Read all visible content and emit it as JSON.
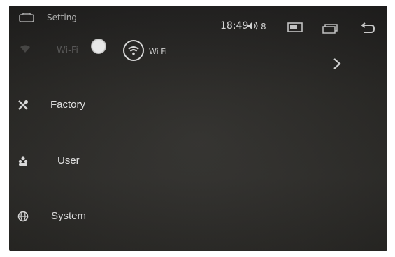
{
  "header": {
    "title": "Setting",
    "home_icon": "home-icon"
  },
  "status": {
    "time": "18:49",
    "volume_level": "8",
    "icons": [
      "volume-icon",
      "gallery-icon",
      "windows-icon",
      "back-icon"
    ]
  },
  "wifi": {
    "label": "Wi-Fi",
    "toggle_state": "on",
    "network_name": "Wi Fi",
    "icons": [
      "wifi-signal-icon",
      "wifi-network-icon",
      "chevron-right-icon"
    ]
  },
  "menu": {
    "items": [
      {
        "label": "Factory",
        "icon": "tools-icon"
      },
      {
        "label": "User",
        "icon": "users-icon"
      },
      {
        "label": "System",
        "icon": "globe-icon"
      }
    ]
  },
  "colors": {
    "screen_bg": "#2b2a27",
    "text": "#f0f0f0",
    "dim_text": "#5e5e5e"
  }
}
